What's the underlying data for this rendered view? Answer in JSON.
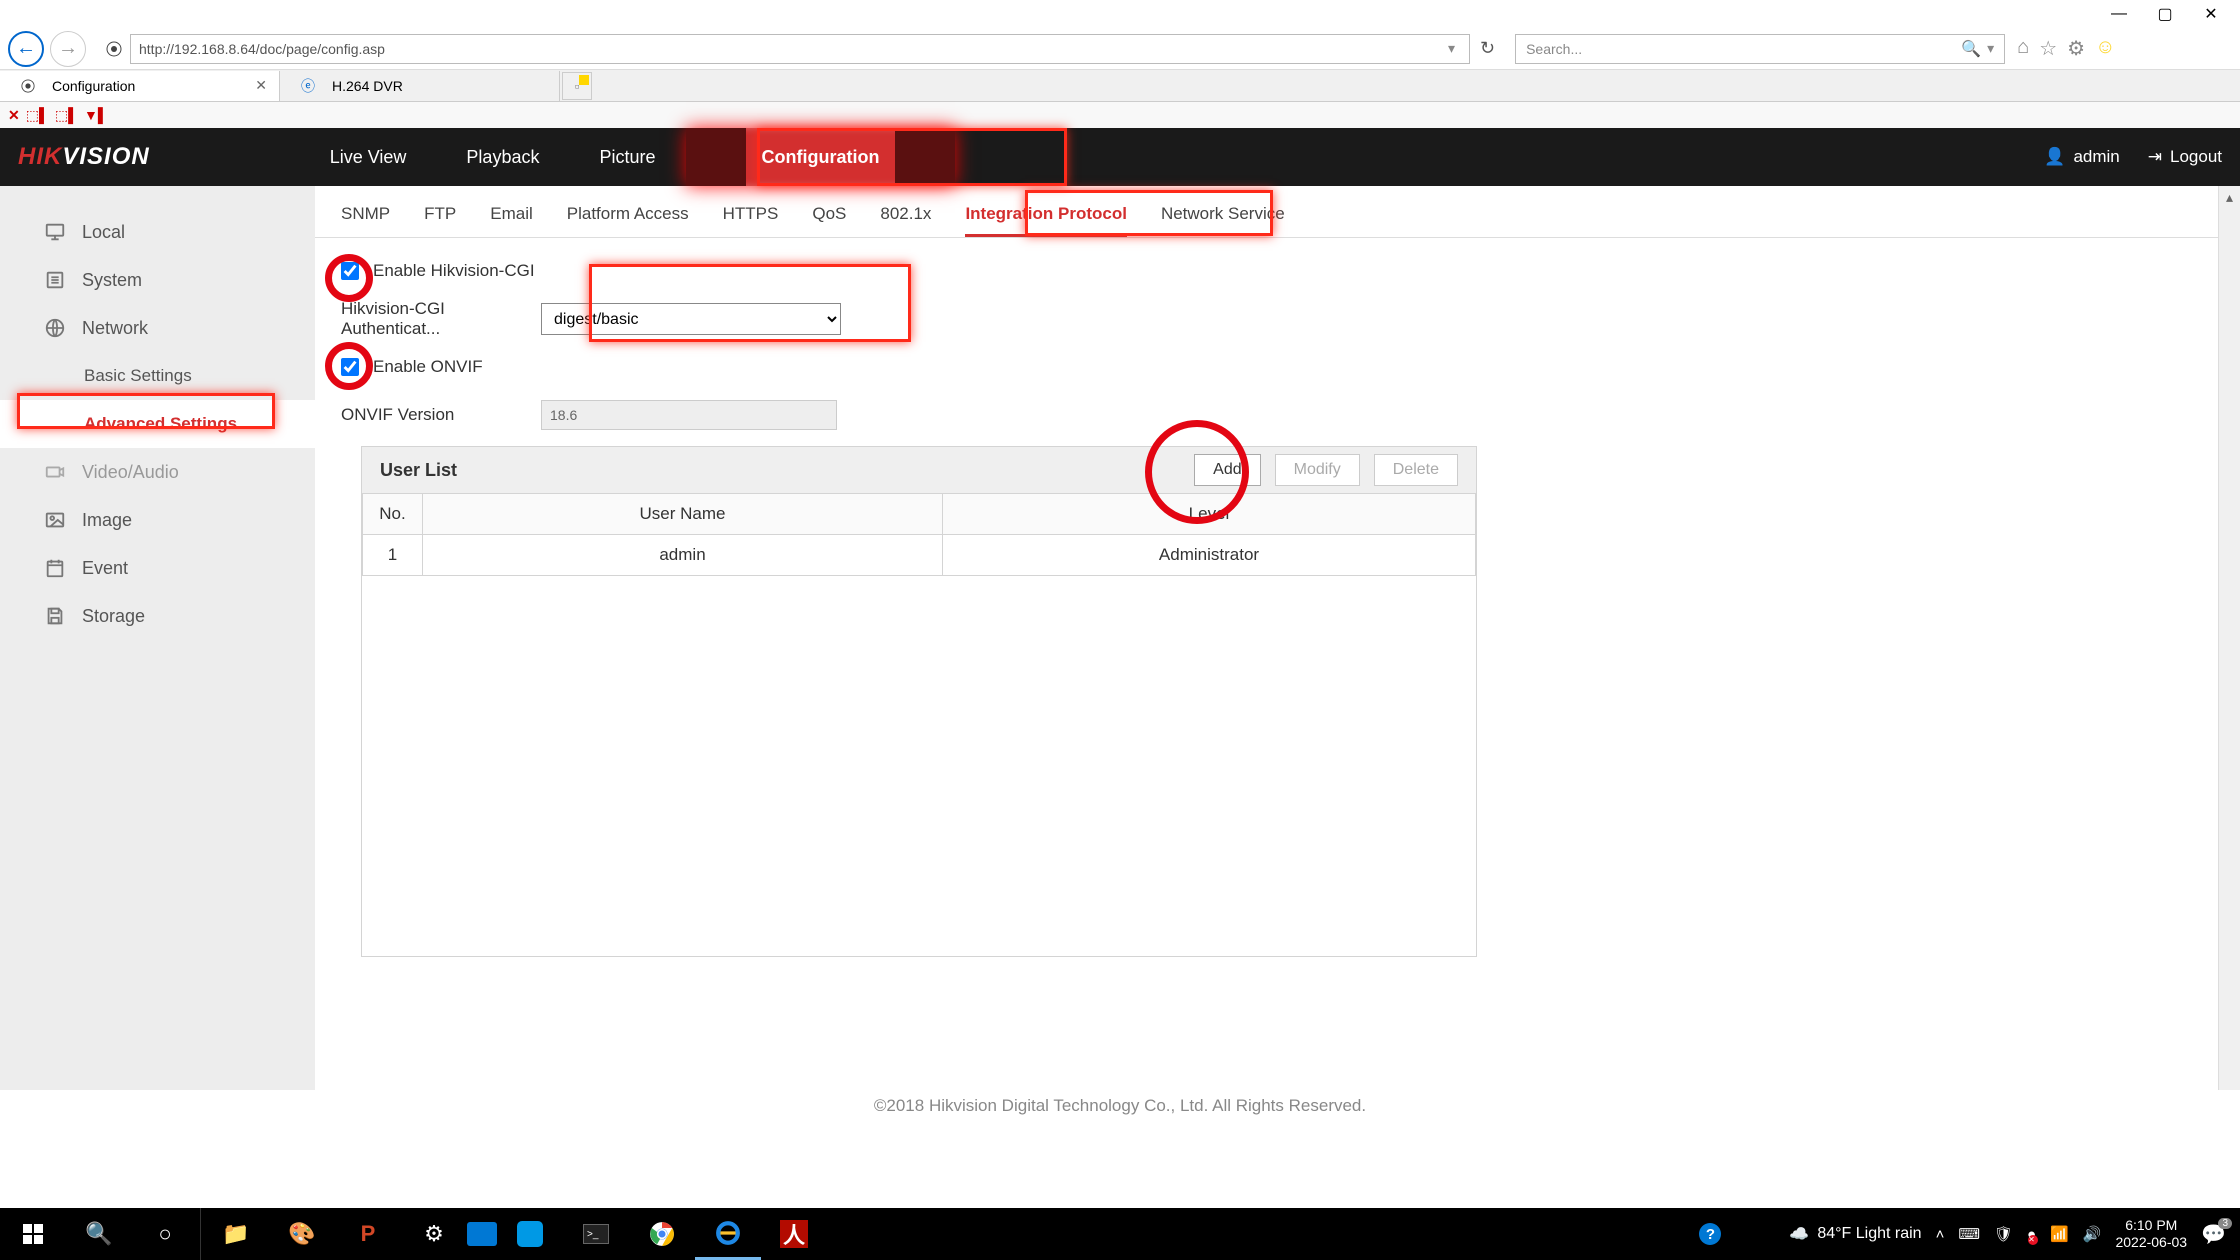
{
  "window": {
    "url": "http://192.168.8.64/doc/page/config.asp",
    "search_placeholder": "Search..."
  },
  "tabs": [
    {
      "title": "Configuration",
      "active": true
    },
    {
      "title": "H.264 DVR",
      "active": false
    }
  ],
  "nav": {
    "logo_prefix": "HIK",
    "logo_suffix": "VISION",
    "items": [
      "Live View",
      "Playback",
      "Picture",
      "Configuration"
    ],
    "active": "Configuration",
    "user": "admin",
    "logout": "Logout"
  },
  "sidebar": {
    "items": [
      {
        "label": "Local",
        "icon": "monitor"
      },
      {
        "label": "System",
        "icon": "list"
      },
      {
        "label": "Network",
        "icon": "globe",
        "children": [
          {
            "label": "Basic Settings"
          },
          {
            "label": "Advanced Settings",
            "active": true
          }
        ]
      },
      {
        "label": "Video/Audio",
        "icon": "camera",
        "greyed": true
      },
      {
        "label": "Image",
        "icon": "image"
      },
      {
        "label": "Event",
        "icon": "calendar"
      },
      {
        "label": "Storage",
        "icon": "save"
      }
    ]
  },
  "subtabs": [
    "SNMP",
    "FTP",
    "Email",
    "Platform Access",
    "HTTPS",
    "QoS",
    "802.1x",
    "Integration Protocol",
    "Network Service"
  ],
  "subtab_active": "Integration Protocol",
  "form": {
    "enable_cgi_label": "Enable Hikvision-CGI",
    "enable_cgi": true,
    "auth_label": "Hikvision-CGI Authenticat...",
    "auth_value": "digest/basic",
    "enable_onvif_label": "Enable ONVIF",
    "enable_onvif": true,
    "onvif_version_label": "ONVIF Version",
    "onvif_version": "18.6"
  },
  "userlist": {
    "title": "User List",
    "buttons": {
      "add": "Add",
      "modify": "Modify",
      "delete": "Delete"
    },
    "columns": [
      "No.",
      "User Name",
      "Level"
    ],
    "rows": [
      {
        "no": "1",
        "username": "admin",
        "level": "Administrator"
      }
    ]
  },
  "footer": "©2018 Hikvision Digital Technology Co., Ltd. All Rights Reserved.",
  "taskbar": {
    "weather": "84°F  Light rain",
    "time": "6:10 PM",
    "date": "2022-06-03",
    "notif_badge": "3"
  }
}
